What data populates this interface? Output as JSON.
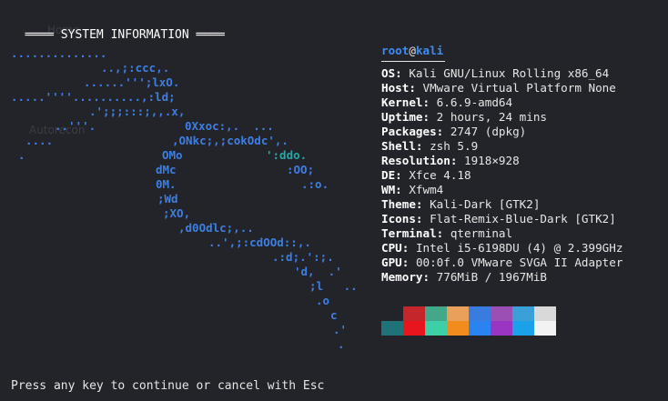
{
  "background_labels": [
    "Home",
    "Autorecon"
  ],
  "header": {
    "title": "SYSTEM INFORMATION"
  },
  "ascii_logo": [
    {
      "text": "..............",
      "teal": false
    },
    {
      "text": "..,;:ccc,.",
      "teal": false
    },
    {
      "text": "......''';lxO.",
      "teal": false
    },
    {
      "text": ".....''''..........,:ld;",
      "teal": false
    },
    {
      "text": ".';;;:::;,,.x,",
      "teal": false
    },
    {
      "text": "..'''.",
      "teal": false
    },
    {
      "text": "0Xxoc:,.  ...",
      "teal": false
    },
    {
      "text": "....",
      "teal": false
    },
    {
      "text": ",ONkc;,;cokOdc',.",
      "teal": false
    },
    {
      "text": ".",
      "teal": false
    },
    {
      "text": "OMo",
      "teal": false
    },
    {
      "text": "':ddo.",
      "teal": true
    },
    {
      "text": "dMc",
      "teal": false
    },
    {
      "text": ":OO;",
      "teal": false
    },
    {
      "text": "0M.",
      "teal": false
    },
    {
      "text": ".:o.",
      "teal": false
    },
    {
      "text": ";Wd",
      "teal": false
    },
    {
      "text": ";XO,",
      "teal": false
    },
    {
      "text": ",d0Odlc;,..",
      "teal": false
    },
    {
      "text": "..',;:cdOOd::,.",
      "teal": false
    },
    {
      "text": ".:d;.':;.",
      "teal": false
    },
    {
      "text": "'d,  .'",
      "teal": false
    },
    {
      "text": ";l   ..",
      "teal": false
    },
    {
      "text": ".o",
      "teal": false
    },
    {
      "text": "c",
      "teal": false
    },
    {
      "text": ".'",
      "teal": false
    },
    {
      "text": ".",
      "teal": false
    }
  ],
  "title": {
    "user": "root",
    "at": "@",
    "host": "kali"
  },
  "info": [
    {
      "key": "OS:",
      "value": "Kali GNU/Linux Rolling x86_64"
    },
    {
      "key": "Host:",
      "value": "VMware Virtual Platform None"
    },
    {
      "key": "Kernel:",
      "value": "6.6.9-amd64"
    },
    {
      "key": "Uptime:",
      "value": "2 hours, 24 mins"
    },
    {
      "key": "Packages:",
      "value": "2747 (dpkg)"
    },
    {
      "key": "Shell:",
      "value": "zsh 5.9"
    },
    {
      "key": "Resolution:",
      "value": "1918×928"
    },
    {
      "key": "DE:",
      "value": "Xfce 4.18"
    },
    {
      "key": "WM:",
      "value": "Xfwm4"
    },
    {
      "key": "Theme:",
      "value": "Kali-Dark [GTK2]"
    },
    {
      "key": "Icons:",
      "value": "Flat-Remix-Blue-Dark [GTK2]"
    },
    {
      "key": "Terminal:",
      "value": "qterminal"
    },
    {
      "key": "CPU:",
      "value": "Intel i5-6198DU (4) @ 2.399GHz"
    },
    {
      "key": "GPU:",
      "value": "00:0f.0 VMware SVGA II Adapter"
    },
    {
      "key": "Memory:",
      "value": "776MiB / 1967MiB"
    }
  ],
  "palette": {
    "row1": [
      "#232429",
      "#c4262b",
      "#43a88a",
      "#e8a05a",
      "#3a7be0",
      "#9b4fb5",
      "#3b9fd8",
      "#d9d9d9"
    ],
    "row2": [
      "#1e7278",
      "#e8141e",
      "#3ccfa8",
      "#f28c1d",
      "#2a83f0",
      "#9a34c2",
      "#1ba0ea",
      "#f2f2f2"
    ]
  },
  "footer": {
    "prompt": "Press any key to continue or cancel with Esc"
  },
  "colors": {
    "accent": "#3d8cf2",
    "background": "#232429",
    "logo_teal": "#2aa6a6"
  }
}
